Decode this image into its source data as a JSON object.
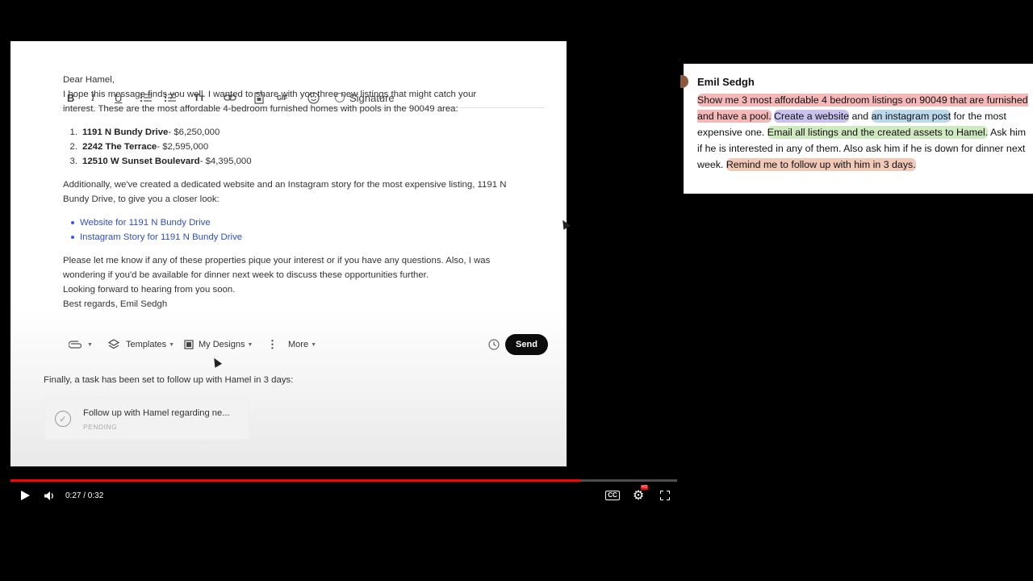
{
  "toolbar": {
    "bold": "B",
    "italic": "I",
    "underline": "U",
    "text_size": "Tт",
    "gif": "GIF",
    "signature_label": "Signature"
  },
  "email": {
    "greeting": "Dear Hamel,",
    "intro_line1": "I hope this message finds you well. I wanted to share with you three new listings that might catch your",
    "intro_line2": "interest. These are the most affordable 4-bedroom furnished homes with pools in the 90049 area:",
    "listings": [
      {
        "num": "1.",
        "address": "1191 N Bundy Drive",
        "price": " - $6,250,000"
      },
      {
        "num": "2.",
        "address": "2242 The Terrace",
        "price": " - $2,595,000"
      },
      {
        "num": "3.",
        "address": "12510 W Sunset Boulevard",
        "price": " - $4,395,000"
      }
    ],
    "additional_line1": "Additionally, we've created a dedicated website and an Instagram story for the most expensive listing, 1191 N",
    "additional_line2": "Bundy Drive, to give you a closer look:",
    "links": [
      "Website for 1191 N Bundy Drive",
      "Instagram Story for 1191 N Bundy Drive"
    ],
    "closing_line1": "Please let me know if any of these properties pique your interest or if you have any questions. Also, I was",
    "closing_line2": "wondering if you'd be available for dinner next week to discuss these opportunities further.",
    "closing_line3": "Looking forward to hearing from you soon.",
    "signoff": "Best regards, Emil Sedgh"
  },
  "compose": {
    "templates": "Templates",
    "my_designs": "My Designs",
    "more": "More",
    "send": "Send"
  },
  "followup": {
    "text": "Finally, a task has been set to follow up with Hamel in 3 days:",
    "task_title": "Follow up with Hamel regarding ne...",
    "task_status": "PENDING"
  },
  "player": {
    "time": "0:27 / 0:32",
    "progress_fraction": 0.855,
    "cc": "CC",
    "hd": "HD"
  },
  "prompt": {
    "name": "Emil Sedgh",
    "segments": [
      {
        "text": "Show me 3 most affordable 4 bedroom listings on 90049 that are furnished and have a pool.",
        "color": "#f4b8b8"
      },
      {
        "text": " ",
        "color": ""
      },
      {
        "text": "Create a website",
        "color": "#c9c2ef"
      },
      {
        "text": " and ",
        "color": ""
      },
      {
        "text": "an instagram post",
        "color": "#bcd9ec"
      },
      {
        "text": " for the most expensive one. ",
        "color": ""
      },
      {
        "text": "Email all listings and the created assets to Hamel.",
        "color": "#cfeac0"
      },
      {
        "text": " Ask him if he is interested in any of them. Also ask him if he is down for dinner next week. ",
        "color": ""
      },
      {
        "text": "Remind me to follow up with him in 3 days.",
        "color": "#f0c9b8"
      }
    ]
  }
}
